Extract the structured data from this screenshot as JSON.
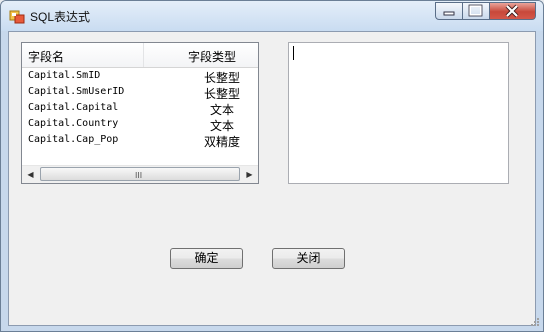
{
  "window": {
    "title": "SQL表达式",
    "icons": {
      "app": "app-window-icon",
      "minimize": "minimize-icon",
      "maximize": "maximize-icon",
      "close": "close-icon"
    }
  },
  "field_list": {
    "columns": [
      "字段名",
      "字段类型"
    ],
    "rows": [
      {
        "name": "Capital.SmID",
        "type": "长整型"
      },
      {
        "name": "Capital.SmUserID",
        "type": "长整型"
      },
      {
        "name": "Capital.Capital",
        "type": "文本"
      },
      {
        "name": "Capital.Country",
        "type": "文本"
      },
      {
        "name": "Capital.Cap_Pop",
        "type": "双精度"
      }
    ],
    "scrollbar": {
      "left_arrow": "◀",
      "right_arrow": "▶",
      "grip": "III"
    }
  },
  "sql_text": "",
  "buttons": {
    "ok": "确定",
    "close": "关闭"
  }
}
